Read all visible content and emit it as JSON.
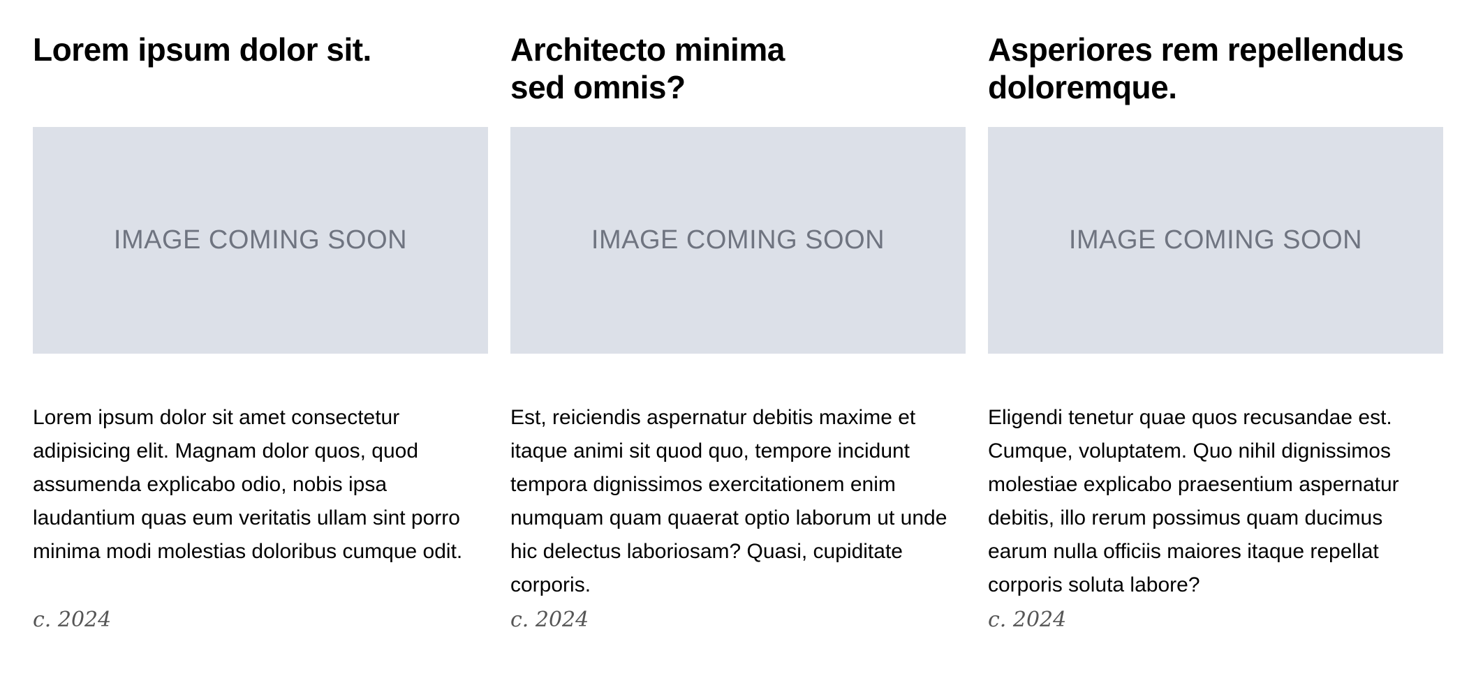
{
  "cards": [
    {
      "title": "Lorem ipsum dolor sit.",
      "image_text": "IMAGE COMING SOON",
      "body": "Lorem ipsum dolor sit amet consectetur adipisicing elit. Magnam dolor quos, quod assumenda explicabo odio, nobis ipsa laudantium quas eum veritatis ullam sint porro minima modi molestias doloribus cumque odit.",
      "date": "c. 2024"
    },
    {
      "title": "Architecto minima sed omnis?",
      "image_text": "IMAGE COMING SOON",
      "body": "Est, reiciendis aspernatur debitis maxime et itaque animi sit quod quo, tempore incidunt tempora dignissimos exercitationem enim numquam quam quaerat optio laborum ut unde hic delectus laboriosam? Quasi, cupiditate corporis.",
      "date": "c. 2024"
    },
    {
      "title": "Asperiores rem repellendus doloremque.",
      "image_text": "IMAGE COMING SOON",
      "body": "Eligendi tenetur quae quos recusandae est. Cumque, voluptatem. Quo nihil dignissimos molestiae explicabo praesentium aspernatur debitis, illo rerum possimus quam ducimus earum nulla officiis maiores itaque repellat corporis soluta labore?",
      "date": "c. 2024"
    }
  ],
  "colors": {
    "placeholder_bg": "#dce0e8",
    "placeholder_text": "#6f7480",
    "date_text": "#555555"
  }
}
